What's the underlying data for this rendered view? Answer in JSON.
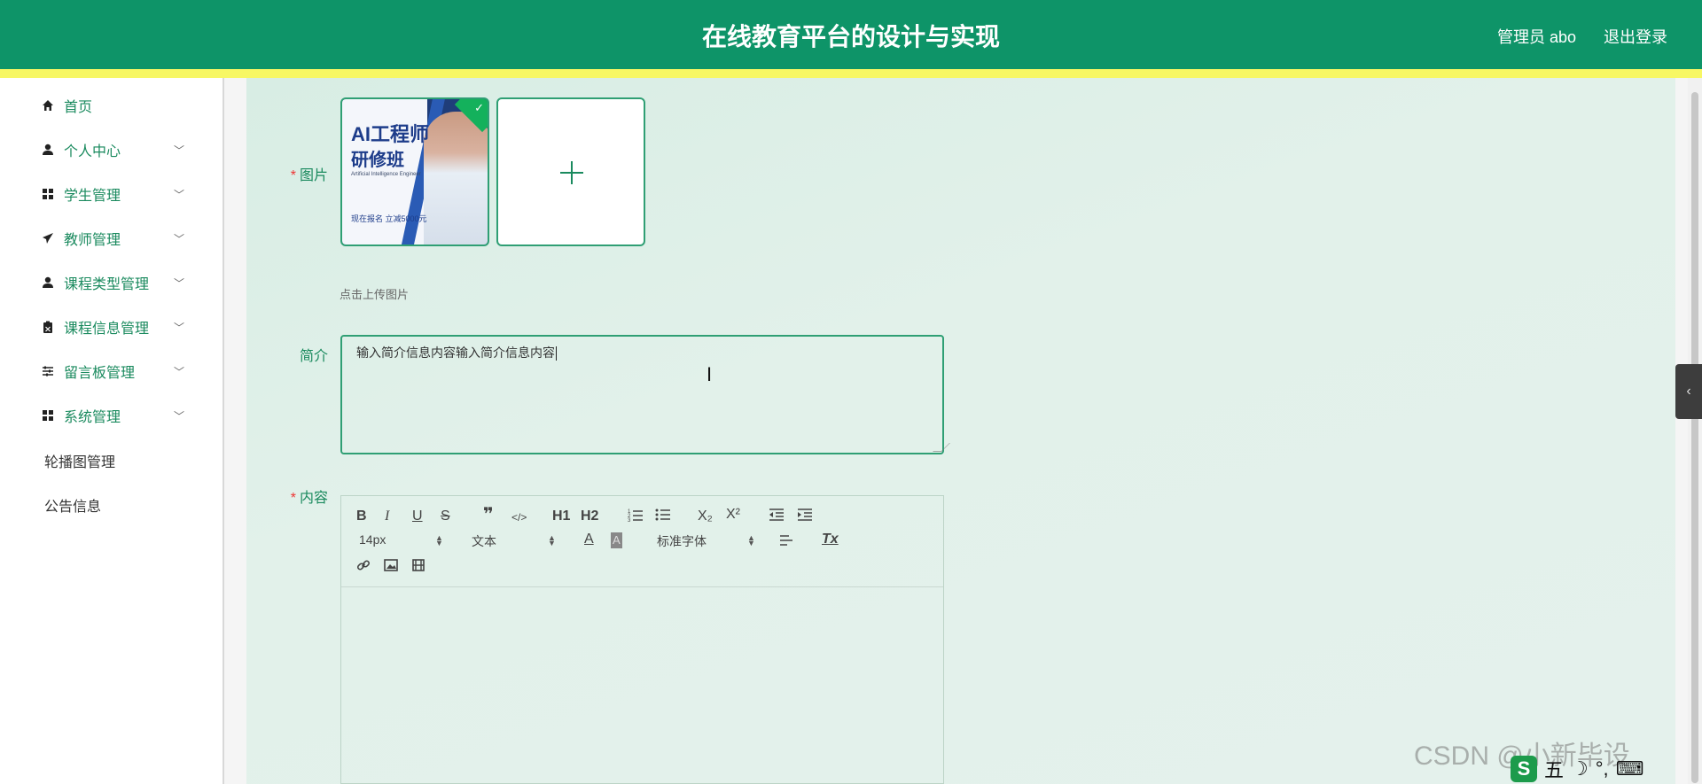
{
  "header": {
    "title": "在线教育平台的设计与实现",
    "user": "管理员 abo",
    "logout": "退出登录"
  },
  "sidebar": {
    "items": [
      {
        "label": "首页",
        "icon": "home-icon",
        "chevron": false
      },
      {
        "label": "个人中心",
        "icon": "user-icon",
        "chevron": true
      },
      {
        "label": "学生管理",
        "icon": "grid-icon",
        "chevron": true
      },
      {
        "label": "教师管理",
        "icon": "send-icon",
        "chevron": true
      },
      {
        "label": "课程类型管理",
        "icon": "user-icon",
        "chevron": true
      },
      {
        "label": "课程信息管理",
        "icon": "clipboard-icon",
        "chevron": true
      },
      {
        "label": "留言板管理",
        "icon": "sliders-icon",
        "chevron": true
      },
      {
        "label": "系统管理",
        "icon": "grid-icon",
        "chevron": true
      }
    ],
    "subitems": [
      {
        "label": "轮播图管理"
      },
      {
        "label": "公告信息"
      }
    ]
  },
  "form": {
    "image_label": "图片",
    "image_thumb": {
      "line1": "AI工程师",
      "line2": "研修班",
      "line3": "Artificial Intelligence Engineer",
      "line4": "现在报名 立减5000元"
    },
    "upload_hint": "点击上传图片",
    "intro_label": "简介",
    "intro_value": "输入简介信息内容输入简介信息内容",
    "content_label": "内容",
    "required_mark": "*"
  },
  "editor": {
    "font_size": "14px",
    "block_type": "文本",
    "font_family": "标准字体",
    "buttons": [
      "B",
      "I",
      "U",
      "S",
      "❞",
      "</>",
      "H1",
      "H2",
      "ordered-list",
      "bullet-list",
      "X₂",
      "X²",
      "outdent",
      "indent",
      "A",
      "A",
      "align-left",
      "Tx",
      "link",
      "image",
      "video"
    ]
  },
  "watermark": "CSDN @小新毕设",
  "colors": {
    "header": "#0e9468",
    "accent": "#1a8a5e",
    "yellow": "#f7f764"
  }
}
